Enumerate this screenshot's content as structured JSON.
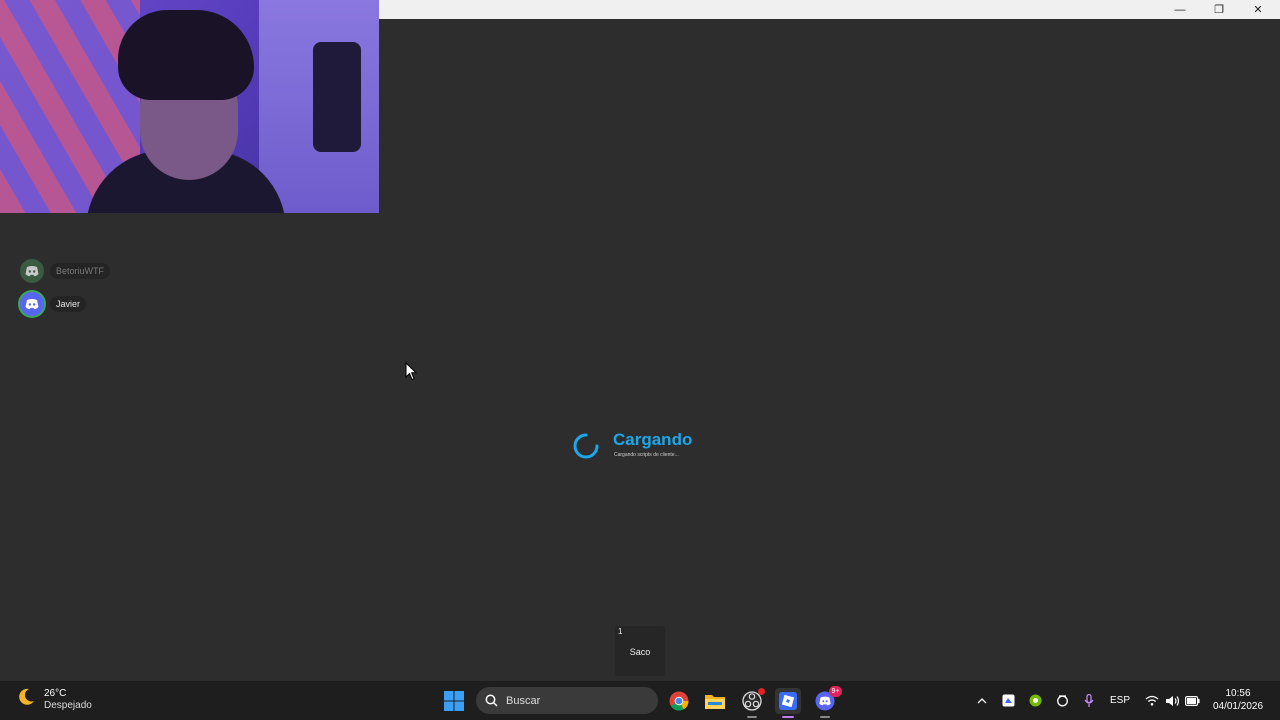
{
  "window": {
    "controls": {
      "minimize": "—",
      "maximize": "❐",
      "close": "✕"
    }
  },
  "voice": {
    "users": [
      {
        "name": "BetoriuWTF",
        "speaking": false
      },
      {
        "name": "Javier",
        "speaking": true
      }
    ]
  },
  "loading": {
    "title": "Cargando",
    "subtitle": "Cargando scripts de cliente..."
  },
  "hotbar": {
    "slot_number": "1",
    "slot_label": "Saco"
  },
  "taskbar": {
    "weather": {
      "temp": "26°C",
      "condition": "Despejado",
      "icon": "moon-icon"
    },
    "search_placeholder": "Buscar",
    "apps": [
      "windows-start-icon",
      "chrome-icon",
      "file-explorer-icon",
      "obs-icon",
      "roblox-icon",
      "discord-icon"
    ],
    "discord_badge": "9+",
    "tray": {
      "language": "ESP"
    },
    "clock": {
      "time": "10:56",
      "date": "04/01/2026"
    }
  }
}
